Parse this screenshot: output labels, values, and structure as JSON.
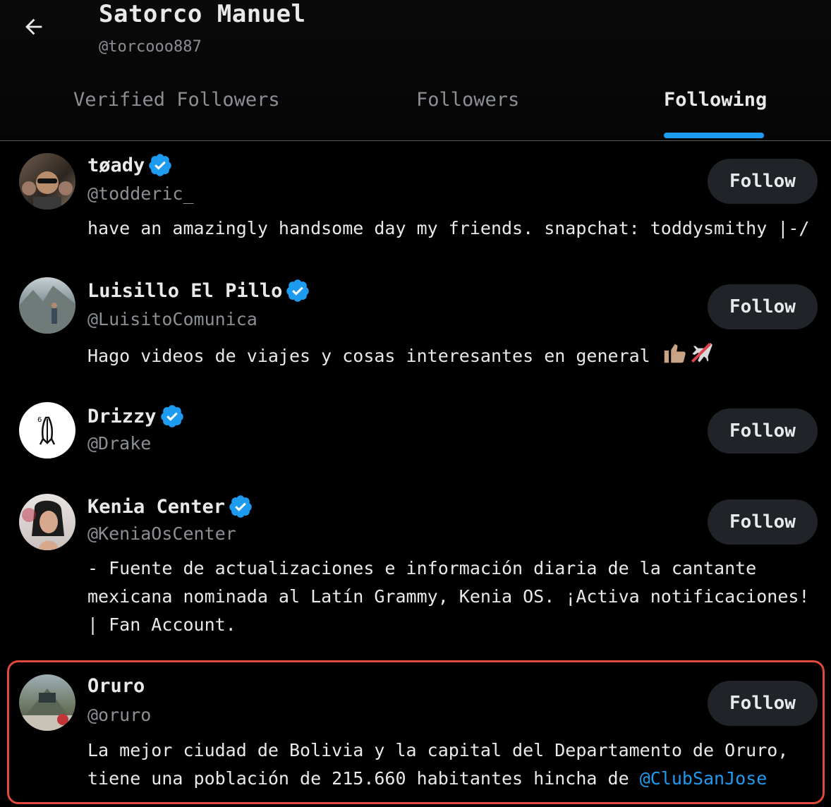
{
  "header": {
    "name": "Satorco Manuel",
    "handle": "@torcooo887"
  },
  "tabs": [
    {
      "label": "Verified Followers",
      "active": false
    },
    {
      "label": "Followers",
      "active": false
    },
    {
      "label": "Following",
      "active": true
    }
  ],
  "colors": {
    "accent": "#1d9bf0",
    "background": "#000000",
    "muted_text": "#8b8f94",
    "button_bg": "#202327",
    "highlight_border": "#e0493b"
  },
  "follow_label": "Follow",
  "users": [
    {
      "name": "tøady",
      "verified": true,
      "handle": "@todderic_",
      "bio": "have an amazingly handsome day my friends. snapchat: toddysmithy |-/",
      "avatar_icon": "avatar-photo"
    },
    {
      "name": "Luisillo El Pillo",
      "verified": true,
      "handle": "@LuisitoComunica",
      "bio": "Hago videos de viajes y cosas interesantes en general",
      "bio_emoji": [
        "thumbs-up-icon",
        "airplane-icon"
      ],
      "avatar_icon": "avatar-photo"
    },
    {
      "name": "Drizzy",
      "verified": true,
      "handle": "@Drake",
      "bio": "",
      "avatar_icon": "praying-hands-icon"
    },
    {
      "name": "Kenia Center",
      "verified": true,
      "handle": "@KeniaOsCenter",
      "bio": "- Fuente de actualizaciones e información diaria de la cantante mexicana nominada al Latín Grammy, Kenia OS. ¡Activa notificaciones! | Fan Account.",
      "avatar_icon": "avatar-photo"
    },
    {
      "name": "Oruro",
      "verified": false,
      "handle": "@oruro",
      "bio": "La mejor ciudad de Bolivia y la capital del Departamento de Oruro, tiene una población de 215.660 habitantes hincha de",
      "bio_mention": "@ClubSanJose",
      "avatar_icon": "avatar-photo",
      "highlighted": true
    }
  ]
}
